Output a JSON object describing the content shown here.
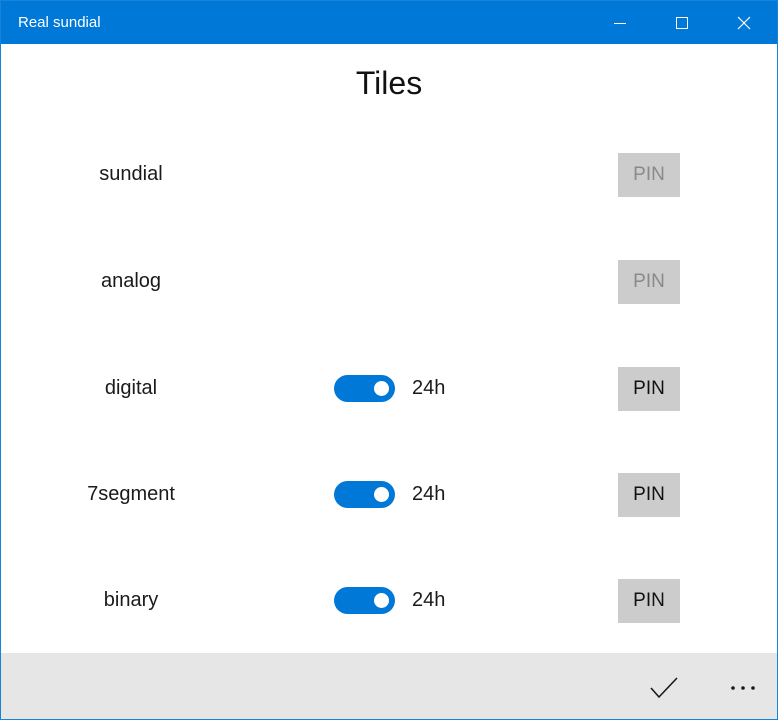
{
  "window": {
    "title": "Real sundial",
    "accent": "#0078d7",
    "caption_icons": [
      "minimize-icon",
      "maximize-icon",
      "close-icon"
    ]
  },
  "page": {
    "title": "Tiles"
  },
  "tiles": [
    {
      "name": "sundial",
      "toggle": null,
      "pin_label": "PIN",
      "pin_enabled": false
    },
    {
      "name": "analog",
      "toggle": null,
      "pin_label": "PIN",
      "pin_enabled": false
    },
    {
      "name": "digital",
      "toggle": {
        "on": true,
        "label": "24h"
      },
      "pin_label": "PIN",
      "pin_enabled": true
    },
    {
      "name": "7segment",
      "toggle": {
        "on": true,
        "label": "24h"
      },
      "pin_label": "PIN",
      "pin_enabled": true
    },
    {
      "name": "binary",
      "toggle": {
        "on": true,
        "label": "24h"
      },
      "pin_label": "PIN",
      "pin_enabled": true
    }
  ],
  "app_bar": {
    "background": "#e6e6e6",
    "icons": [
      "checkmark-icon",
      "more-icon"
    ]
  }
}
